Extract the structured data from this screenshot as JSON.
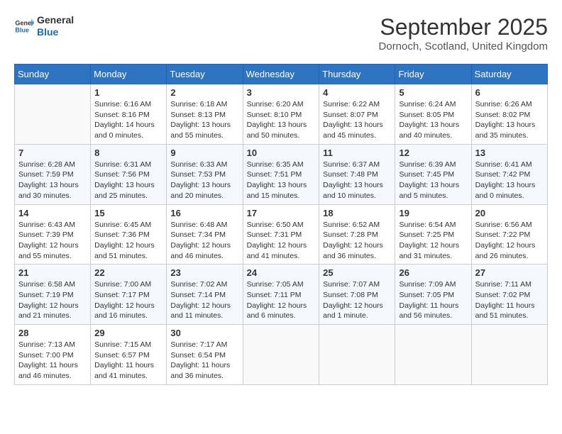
{
  "header": {
    "logo_line1": "General",
    "logo_line2": "Blue",
    "month": "September 2025",
    "location": "Dornoch, Scotland, United Kingdom"
  },
  "days_of_week": [
    "Sunday",
    "Monday",
    "Tuesday",
    "Wednesday",
    "Thursday",
    "Friday",
    "Saturday"
  ],
  "weeks": [
    [
      {
        "day": "",
        "sunrise": "",
        "sunset": "",
        "daylight": ""
      },
      {
        "day": "1",
        "sunrise": "Sunrise: 6:16 AM",
        "sunset": "Sunset: 8:16 PM",
        "daylight": "Daylight: 14 hours and 0 minutes."
      },
      {
        "day": "2",
        "sunrise": "Sunrise: 6:18 AM",
        "sunset": "Sunset: 8:13 PM",
        "daylight": "Daylight: 13 hours and 55 minutes."
      },
      {
        "day": "3",
        "sunrise": "Sunrise: 6:20 AM",
        "sunset": "Sunset: 8:10 PM",
        "daylight": "Daylight: 13 hours and 50 minutes."
      },
      {
        "day": "4",
        "sunrise": "Sunrise: 6:22 AM",
        "sunset": "Sunset: 8:07 PM",
        "daylight": "Daylight: 13 hours and 45 minutes."
      },
      {
        "day": "5",
        "sunrise": "Sunrise: 6:24 AM",
        "sunset": "Sunset: 8:05 PM",
        "daylight": "Daylight: 13 hours and 40 minutes."
      },
      {
        "day": "6",
        "sunrise": "Sunrise: 6:26 AM",
        "sunset": "Sunset: 8:02 PM",
        "daylight": "Daylight: 13 hours and 35 minutes."
      }
    ],
    [
      {
        "day": "7",
        "sunrise": "Sunrise: 6:28 AM",
        "sunset": "Sunset: 7:59 PM",
        "daylight": "Daylight: 13 hours and 30 minutes."
      },
      {
        "day": "8",
        "sunrise": "Sunrise: 6:31 AM",
        "sunset": "Sunset: 7:56 PM",
        "daylight": "Daylight: 13 hours and 25 minutes."
      },
      {
        "day": "9",
        "sunrise": "Sunrise: 6:33 AM",
        "sunset": "Sunset: 7:53 PM",
        "daylight": "Daylight: 13 hours and 20 minutes."
      },
      {
        "day": "10",
        "sunrise": "Sunrise: 6:35 AM",
        "sunset": "Sunset: 7:51 PM",
        "daylight": "Daylight: 13 hours and 15 minutes."
      },
      {
        "day": "11",
        "sunrise": "Sunrise: 6:37 AM",
        "sunset": "Sunset: 7:48 PM",
        "daylight": "Daylight: 13 hours and 10 minutes."
      },
      {
        "day": "12",
        "sunrise": "Sunrise: 6:39 AM",
        "sunset": "Sunset: 7:45 PM",
        "daylight": "Daylight: 13 hours and 5 minutes."
      },
      {
        "day": "13",
        "sunrise": "Sunrise: 6:41 AM",
        "sunset": "Sunset: 7:42 PM",
        "daylight": "Daylight: 13 hours and 0 minutes."
      }
    ],
    [
      {
        "day": "14",
        "sunrise": "Sunrise: 6:43 AM",
        "sunset": "Sunset: 7:39 PM",
        "daylight": "Daylight: 12 hours and 55 minutes."
      },
      {
        "day": "15",
        "sunrise": "Sunrise: 6:45 AM",
        "sunset": "Sunset: 7:36 PM",
        "daylight": "Daylight: 12 hours and 51 minutes."
      },
      {
        "day": "16",
        "sunrise": "Sunrise: 6:48 AM",
        "sunset": "Sunset: 7:34 PM",
        "daylight": "Daylight: 12 hours and 46 minutes."
      },
      {
        "day": "17",
        "sunrise": "Sunrise: 6:50 AM",
        "sunset": "Sunset: 7:31 PM",
        "daylight": "Daylight: 12 hours and 41 minutes."
      },
      {
        "day": "18",
        "sunrise": "Sunrise: 6:52 AM",
        "sunset": "Sunset: 7:28 PM",
        "daylight": "Daylight: 12 hours and 36 minutes."
      },
      {
        "day": "19",
        "sunrise": "Sunrise: 6:54 AM",
        "sunset": "Sunset: 7:25 PM",
        "daylight": "Daylight: 12 hours and 31 minutes."
      },
      {
        "day": "20",
        "sunrise": "Sunrise: 6:56 AM",
        "sunset": "Sunset: 7:22 PM",
        "daylight": "Daylight: 12 hours and 26 minutes."
      }
    ],
    [
      {
        "day": "21",
        "sunrise": "Sunrise: 6:58 AM",
        "sunset": "Sunset: 7:19 PM",
        "daylight": "Daylight: 12 hours and 21 minutes."
      },
      {
        "day": "22",
        "sunrise": "Sunrise: 7:00 AM",
        "sunset": "Sunset: 7:17 PM",
        "daylight": "Daylight: 12 hours and 16 minutes."
      },
      {
        "day": "23",
        "sunrise": "Sunrise: 7:02 AM",
        "sunset": "Sunset: 7:14 PM",
        "daylight": "Daylight: 12 hours and 11 minutes."
      },
      {
        "day": "24",
        "sunrise": "Sunrise: 7:05 AM",
        "sunset": "Sunset: 7:11 PM",
        "daylight": "Daylight: 12 hours and 6 minutes."
      },
      {
        "day": "25",
        "sunrise": "Sunrise: 7:07 AM",
        "sunset": "Sunset: 7:08 PM",
        "daylight": "Daylight: 12 hours and 1 minute."
      },
      {
        "day": "26",
        "sunrise": "Sunrise: 7:09 AM",
        "sunset": "Sunset: 7:05 PM",
        "daylight": "Daylight: 11 hours and 56 minutes."
      },
      {
        "day": "27",
        "sunrise": "Sunrise: 7:11 AM",
        "sunset": "Sunset: 7:02 PM",
        "daylight": "Daylight: 11 hours and 51 minutes."
      }
    ],
    [
      {
        "day": "28",
        "sunrise": "Sunrise: 7:13 AM",
        "sunset": "Sunset: 7:00 PM",
        "daylight": "Daylight: 11 hours and 46 minutes."
      },
      {
        "day": "29",
        "sunrise": "Sunrise: 7:15 AM",
        "sunset": "Sunset: 6:57 PM",
        "daylight": "Daylight: 11 hours and 41 minutes."
      },
      {
        "day": "30",
        "sunrise": "Sunrise: 7:17 AM",
        "sunset": "Sunset: 6:54 PM",
        "daylight": "Daylight: 11 hours and 36 minutes."
      },
      {
        "day": "",
        "sunrise": "",
        "sunset": "",
        "daylight": ""
      },
      {
        "day": "",
        "sunrise": "",
        "sunset": "",
        "daylight": ""
      },
      {
        "day": "",
        "sunrise": "",
        "sunset": "",
        "daylight": ""
      },
      {
        "day": "",
        "sunrise": "",
        "sunset": "",
        "daylight": ""
      }
    ]
  ]
}
